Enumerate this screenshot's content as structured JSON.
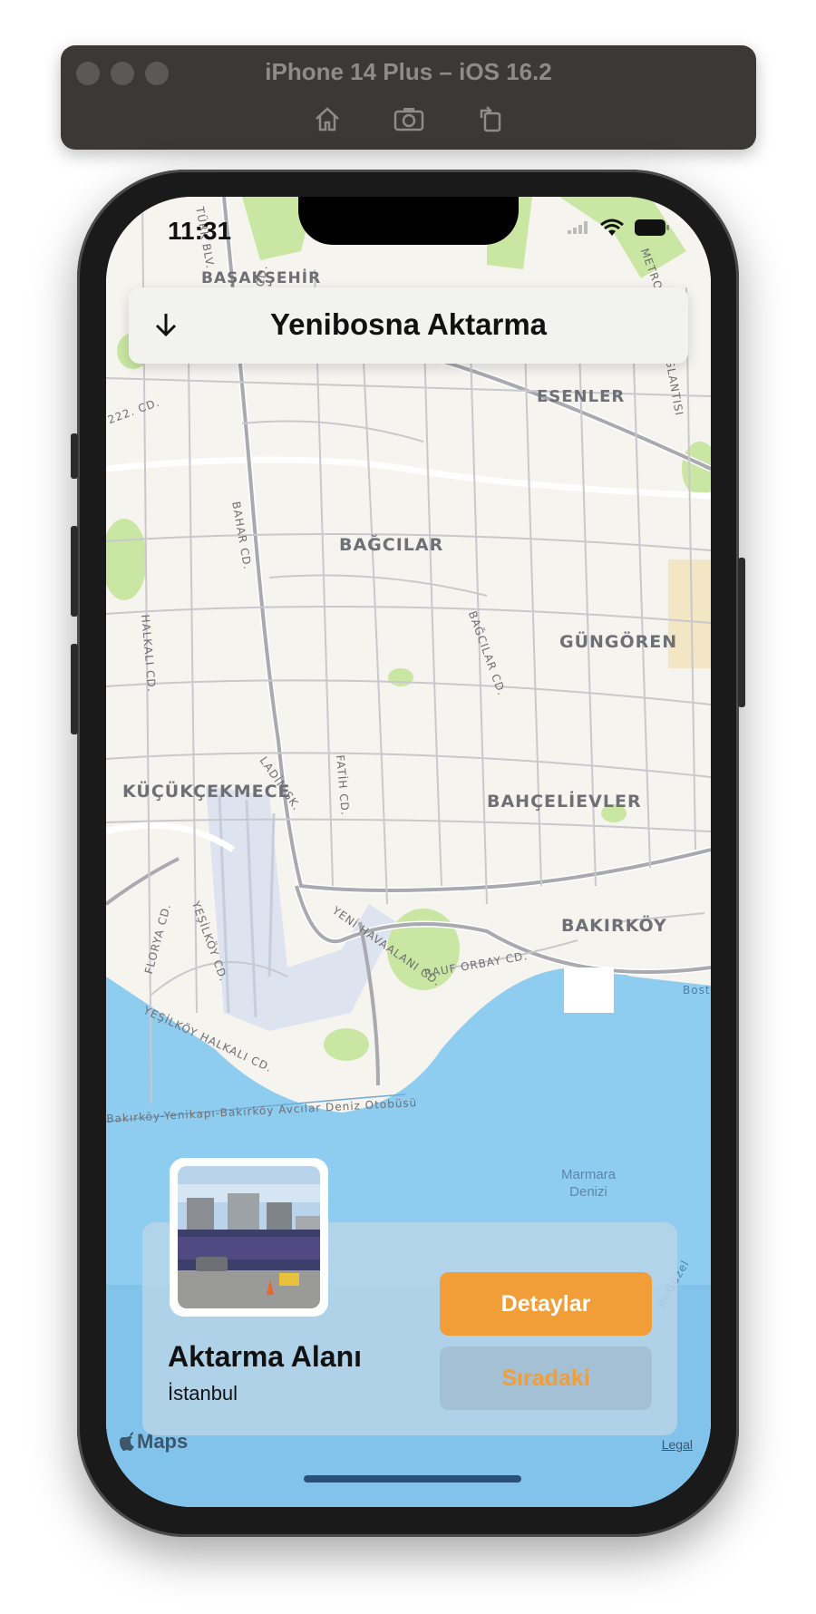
{
  "simulator": {
    "title": "iPhone 14 Plus – iOS 16.2",
    "toolbar_icons": [
      "home-icon",
      "screenshot-icon",
      "rotate-icon"
    ]
  },
  "status_bar": {
    "time": "11:31",
    "icons": [
      "signal-icon",
      "wifi-icon",
      "battery-icon"
    ]
  },
  "header": {
    "back_icon": "arrow-down-icon",
    "title": "Yenibosna Aktarma"
  },
  "map": {
    "districts": [
      "BAŞAKŞEHİR",
      "ESENLER",
      "BAĞCILAR",
      "GÜNGÖREN",
      "KÜÇÜKÇEKMECE",
      "BAHÇELİEVLER",
      "BAKIRKÖY"
    ],
    "roads": [
      "TÜRK BLV.",
      "BAHARİYE CD.",
      "BAHAR CD.",
      "HALKALI CD.",
      "BAĞCILAR CD.",
      "LADİN SK.",
      "FATİH CD.",
      "YENİ HAVAALANI CD.",
      "RAUF ORBAY CD.",
      "FLORYA CD.",
      "YEŞİLKÖY CD.",
      "YEŞİLKÖY HALKALI CD.",
      "222. CD.",
      "BAĞLANTISI",
      "METRO"
    ],
    "ferry_line": "Bakırköy-Yenikapı-Bakırköy Avcılar Deniz Otobüsü",
    "sea_name": [
      "Marmara",
      "Denizi"
    ],
    "edge_labels": [
      "Bost",
      "pı-Güzel"
    ]
  },
  "card": {
    "image_icon": "station-photo",
    "title": "Aktarma Alanı",
    "subtitle": "İstanbul",
    "primary_button": "Detaylar",
    "secondary_button": "Sıradaki"
  },
  "footer": {
    "maps_logo": "Maps",
    "legal": "Legal"
  },
  "colors": {
    "accent": "#f19d38",
    "sea": "#8fcdf0",
    "land": "#f6f4ef",
    "road": "#b9b9bf",
    "park": "#c4e39b"
  }
}
